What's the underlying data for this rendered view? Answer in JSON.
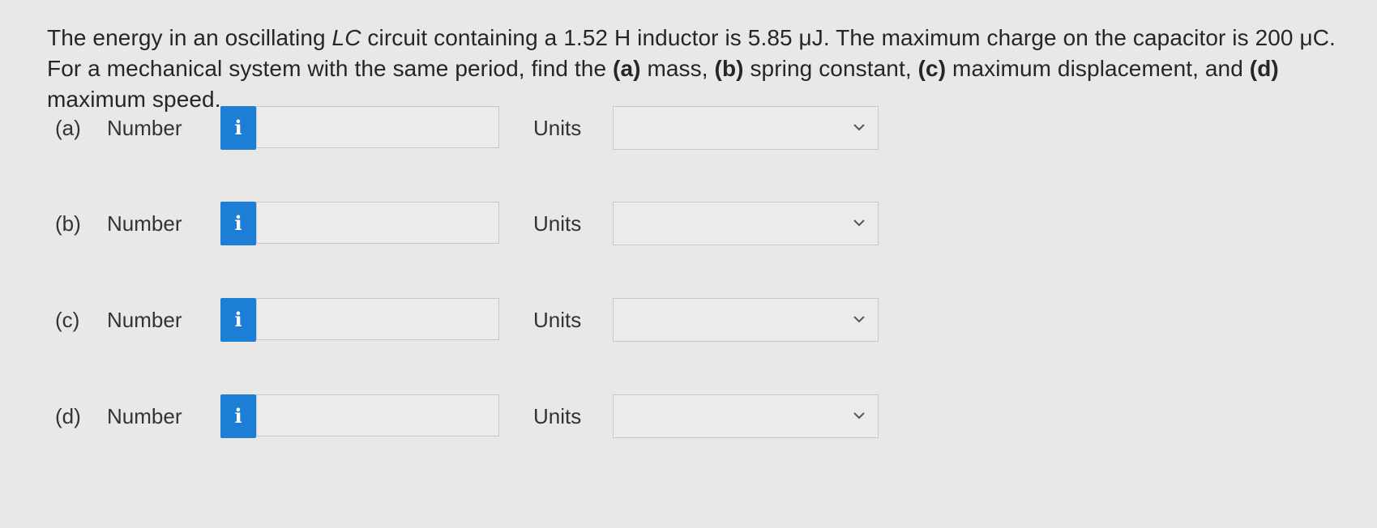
{
  "question": {
    "text_1": "The energy in an oscillating ",
    "lc": "LC",
    "text_2": " circuit containing a 1.52 H inductor is 5.85 μJ. The maximum charge on the capacitor is 200 μC. For a mechanical system with the same period, find the ",
    "a": "(a)",
    "a_text": " mass, ",
    "b": "(b)",
    "b_text": " spring constant, ",
    "c": "(c)",
    "c_text": " maximum displacement, and ",
    "d": "(d)",
    "d_text": " maximum speed."
  },
  "rows": [
    {
      "letter": "(a)",
      "number_label": "Number",
      "info_icon": "i",
      "number_value": "",
      "units_label": "Units",
      "units_value": ""
    },
    {
      "letter": "(b)",
      "number_label": "Number",
      "info_icon": "i",
      "number_value": "",
      "units_label": "Units",
      "units_value": ""
    },
    {
      "letter": "(c)",
      "number_label": "Number",
      "info_icon": "i",
      "number_value": "",
      "units_label": "Units",
      "units_value": ""
    },
    {
      "letter": "(d)",
      "number_label": "Number",
      "info_icon": "i",
      "number_value": "",
      "units_label": "Units",
      "units_value": ""
    }
  ],
  "colors": {
    "info_button": "#1d7ed6",
    "background": "#e9e8e6"
  },
  "icons": {
    "info": "info-icon",
    "dropdown": "chevron-down-icon"
  }
}
